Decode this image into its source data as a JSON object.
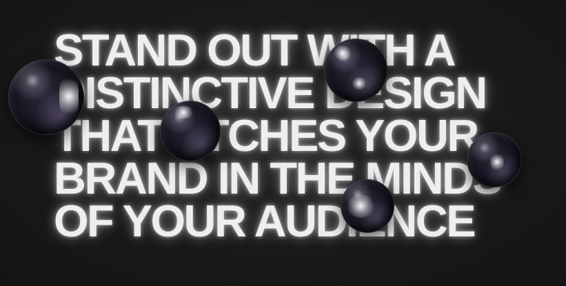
{
  "headline": {
    "lines": [
      "STAND OUT WITH A",
      "DISTINCTIVE DESIGN",
      "THAT ETCHES YOUR",
      "BRAND IN THE MINDS",
      "OF YOUR AUDIENCE"
    ]
  },
  "colors": {
    "background": "#1a1a1a",
    "text": "#eeeeee",
    "sphere": "#15141d"
  }
}
